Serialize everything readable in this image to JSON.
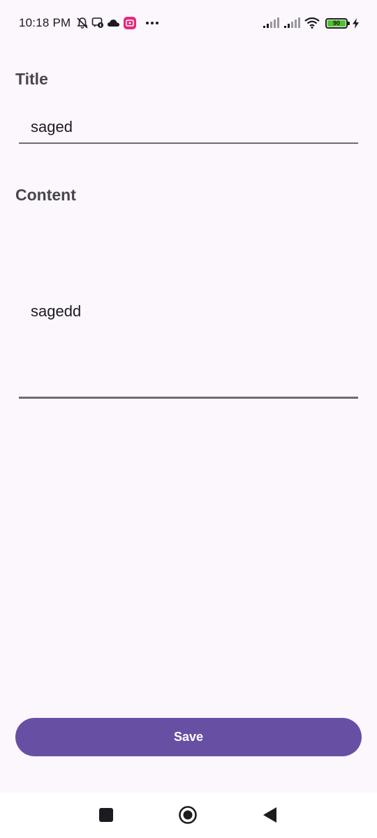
{
  "status_bar": {
    "time": "10:18 PM",
    "battery_level": "90",
    "icons": [
      "muted-bell-icon",
      "chat-notification-icon",
      "cloud-icon",
      "app-notification-icon",
      "more-dots-icon",
      "signal-icon",
      "signal-icon",
      "wifi-icon",
      "battery-icon",
      "charging-icon"
    ]
  },
  "form": {
    "title_label": "Title",
    "title_value": "saged",
    "content_label": "Content",
    "content_value": "sagedd"
  },
  "actions": {
    "save_label": "Save"
  },
  "nav_bar": {
    "icons": [
      "recents-square-icon",
      "home-circle-icon",
      "back-triangle-icon"
    ]
  },
  "colors": {
    "background": "#fcf6fd",
    "primary": "#6750a4",
    "label": "#49454f",
    "underline": "#6e6a75"
  }
}
